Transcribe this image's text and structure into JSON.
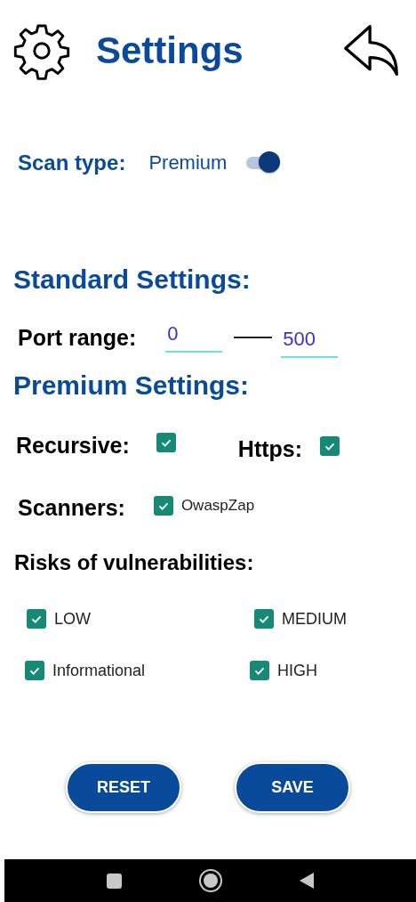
{
  "header": {
    "title": "Settings"
  },
  "scan_type": {
    "label": "Scan type:",
    "value": "Premium",
    "on": true
  },
  "standard": {
    "heading": "Standard Settings:",
    "port_label": "Port range:",
    "port_from": "0",
    "port_to": "500"
  },
  "premium": {
    "heading": "Premium Settings:",
    "options": [
      {
        "label": "Recursive:",
        "checked": true
      },
      {
        "label": "Https:",
        "checked": true
      }
    ],
    "scanners_label": "Scanners:",
    "scanners": [
      {
        "label": "OwaspZap",
        "checked": true
      }
    ]
  },
  "risks": {
    "heading": "Risks of vulnerabilities:",
    "items": [
      {
        "label": "LOW",
        "checked": true
      },
      {
        "label": "MEDIUM",
        "checked": true
      },
      {
        "label": "Informational",
        "checked": true
      },
      {
        "label": "HIGH",
        "checked": true
      }
    ]
  },
  "buttons": [
    "RESET",
    "SAVE"
  ]
}
